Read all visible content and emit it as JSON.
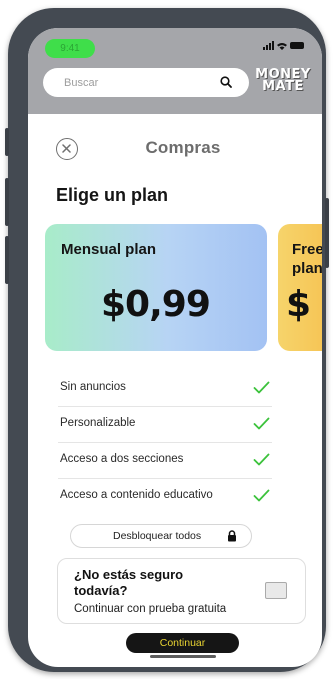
{
  "status_bar": {
    "time": "9:41"
  },
  "search": {
    "placeholder": "Buscar"
  },
  "logo": {
    "line1": "MONEY",
    "line2": "MATE"
  },
  "title": "Compras",
  "section_title": "Elige un plan",
  "plans": [
    {
      "name": "Mensual plan",
      "price": "$0,99"
    },
    {
      "name": "Free plan",
      "price": "$"
    }
  ],
  "features": [
    {
      "label": "Sin anuncios"
    },
    {
      "label": "Personalizable"
    },
    {
      "label": "Acceso a dos secciones"
    },
    {
      "label": "Acceso a contenido educativo"
    }
  ],
  "unlock_button": "Desbloquear todos",
  "trial": {
    "question": "¿No estás seguro todavía?",
    "subtitle": "Continuar con prueba gratuita"
  },
  "continue_button": "Continuar",
  "colors": {
    "accent_yellow": "#e9d432",
    "check_green": "#3cc23c",
    "header_gray": "#a5a6aa",
    "status_green": "#3fde4a"
  }
}
